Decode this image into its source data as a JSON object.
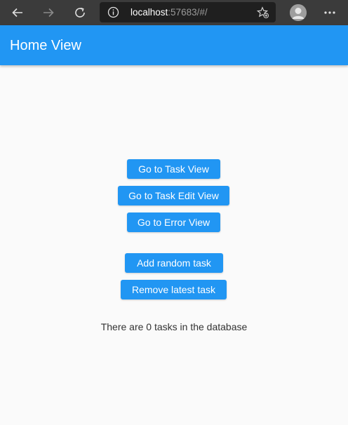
{
  "browser": {
    "url_host": "localhost",
    "url_rest": ":57683/#/",
    "icons": [
      "back-arrow-icon",
      "forward-arrow-icon",
      "refresh-icon",
      "info-icon",
      "favorites-icon",
      "profile-icon",
      "more-icon"
    ]
  },
  "appbar": {
    "title": "Home View",
    "color": "#2196f3"
  },
  "main": {
    "buttons": [
      {
        "label": "Go to Task View"
      },
      {
        "label": "Go to Task Edit View"
      },
      {
        "label": "Go to Error View"
      },
      {
        "label": "Add random task"
      },
      {
        "label": "Remove latest task"
      }
    ],
    "status": "There are 0 tasks in the database"
  }
}
